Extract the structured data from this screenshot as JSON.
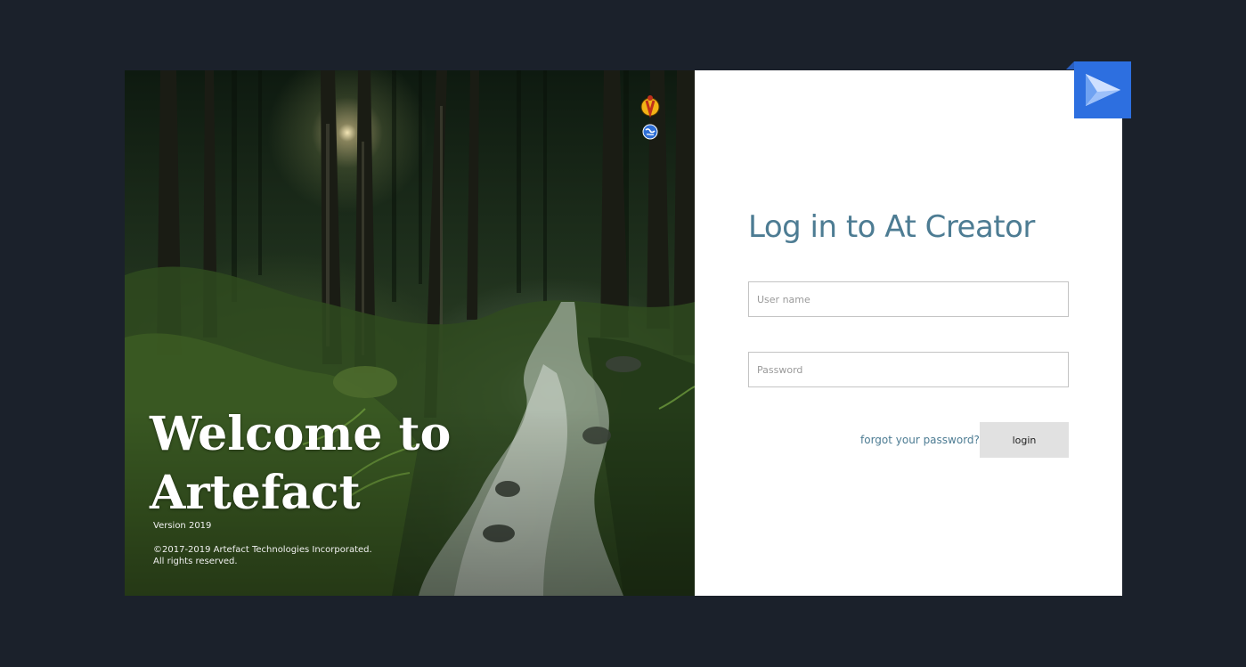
{
  "hero": {
    "title": "Welcome to Artefact",
    "version": "Version 2019",
    "copyright_line1": "©2017-2019 Artefact Technologies Incorporated.",
    "copyright_line2": "All rights reserved.",
    "icons": [
      "user-badge-icon",
      "globe-icon"
    ]
  },
  "login": {
    "title": "Log in to At Creator",
    "username_placeholder": "User name",
    "password_placeholder": "Password",
    "forgot_label": "forgot your password?",
    "login_label": "login"
  },
  "brand": {
    "icon": "play-arrow-logo-icon",
    "accent_color": "#2d6fe0",
    "title_color": "#4d7c93",
    "background_color": "#1b212b"
  }
}
